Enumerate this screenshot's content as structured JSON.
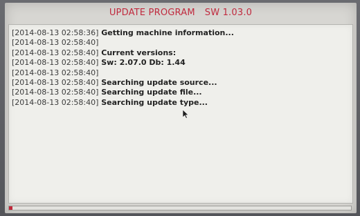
{
  "window": {
    "title": "UPDATE PROGRAM",
    "version": "SW 1.03.0"
  },
  "log": [
    {
      "timestamp": "[2014-08-13 02:58:36]",
      "message": "Getting machine information..."
    },
    {
      "timestamp": "[2014-08-13 02:58:40]",
      "message": ""
    },
    {
      "timestamp": "[2014-08-13 02:58:40]",
      "message": "Current versions:"
    },
    {
      "timestamp": "[2014-08-13 02:58:40]",
      "message": "Sw: 2.07.0  Db: 1.44"
    },
    {
      "timestamp": "[2014-08-13 02:58:40]",
      "message": ""
    },
    {
      "timestamp": "[2014-08-13 02:58:40]",
      "message": "Searching update source..."
    },
    {
      "timestamp": "[2014-08-13 02:58:40]",
      "message": "Searching update file..."
    },
    {
      "timestamp": "[2014-08-13 02:58:40]",
      "message": "Searching update type..."
    }
  ],
  "progress": {
    "fraction": 0.01,
    "fill_color": "#c0283a"
  },
  "icons": {
    "cursor": "mouse-pointer-icon"
  },
  "colors": {
    "title": "#c02a3e",
    "screen_bg": "#d7d6d2",
    "panel_bg": "#efefeb"
  }
}
